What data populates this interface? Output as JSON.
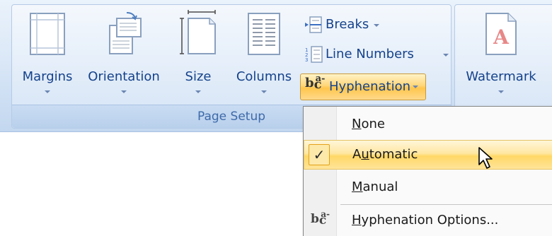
{
  "page_setup_group": {
    "caption": "Page Setup",
    "margins": {
      "label": "Margins",
      "icon": "margins-icon"
    },
    "orientation": {
      "label": "Orientation",
      "icon": "orientation-icon"
    },
    "size": {
      "label": "Size",
      "icon": "size-icon"
    },
    "columns": {
      "label": "Columns",
      "icon": "columns-icon"
    },
    "breaks": {
      "label": "Breaks",
      "icon": "breaks-icon"
    },
    "line_numbers": {
      "label": "Line Numbers",
      "icon": "line-numbers-icon"
    },
    "hyphenation": {
      "label": "Hyphenation",
      "icon": "hyphenation-icon"
    }
  },
  "page_background_group": {
    "watermark": {
      "label": "Watermark",
      "icon": "watermark-icon"
    }
  },
  "hyphenation_menu": {
    "items": [
      {
        "pre": "",
        "acc": "N",
        "post": "one",
        "checked": false
      },
      {
        "pre": "A",
        "acc": "u",
        "post": "tomatic",
        "checked": true,
        "highlighted": true
      },
      {
        "pre": "",
        "acc": "M",
        "post": "anual",
        "checked": false
      },
      {
        "pre": "",
        "acc": "H",
        "post": "yphenation Options...",
        "checked": false,
        "icon": "hyphenation-icon"
      }
    ],
    "check_glyph": "✓"
  },
  "colors": {
    "ribbon_text": "#15428b",
    "highlight": "#ffd867",
    "caption_text": "#3e6aaa"
  }
}
